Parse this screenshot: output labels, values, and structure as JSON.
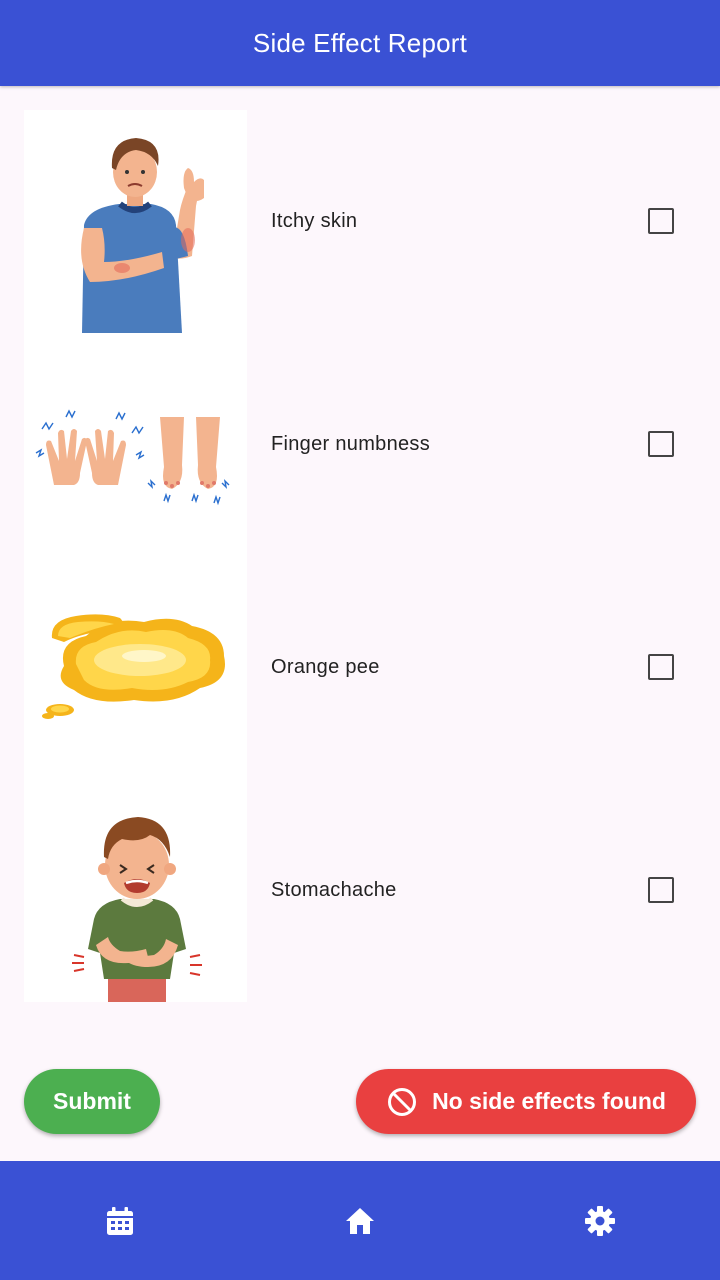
{
  "appbar": {
    "title": "Side Effect Report",
    "color": "#3a51d4"
  },
  "side_effects": [
    {
      "label": "Itchy skin",
      "image": "itchy-skin-illustration",
      "checked": false
    },
    {
      "label": "Finger numbness",
      "image": "finger-numbness-illustration",
      "checked": false
    },
    {
      "label": "Orange pee",
      "image": "orange-pee-illustration",
      "checked": false
    },
    {
      "label": "Stomachache",
      "image": "stomachache-illustration",
      "checked": false
    }
  ],
  "actions": {
    "submit_label": "Submit",
    "submit_color": "#4caf50",
    "none_label": "No side effects found",
    "none_icon": "block-icon",
    "none_color": "#e94040"
  },
  "bottom_nav": [
    {
      "icon": "calendar-icon"
    },
    {
      "icon": "home-icon"
    },
    {
      "icon": "gear-icon"
    }
  ]
}
